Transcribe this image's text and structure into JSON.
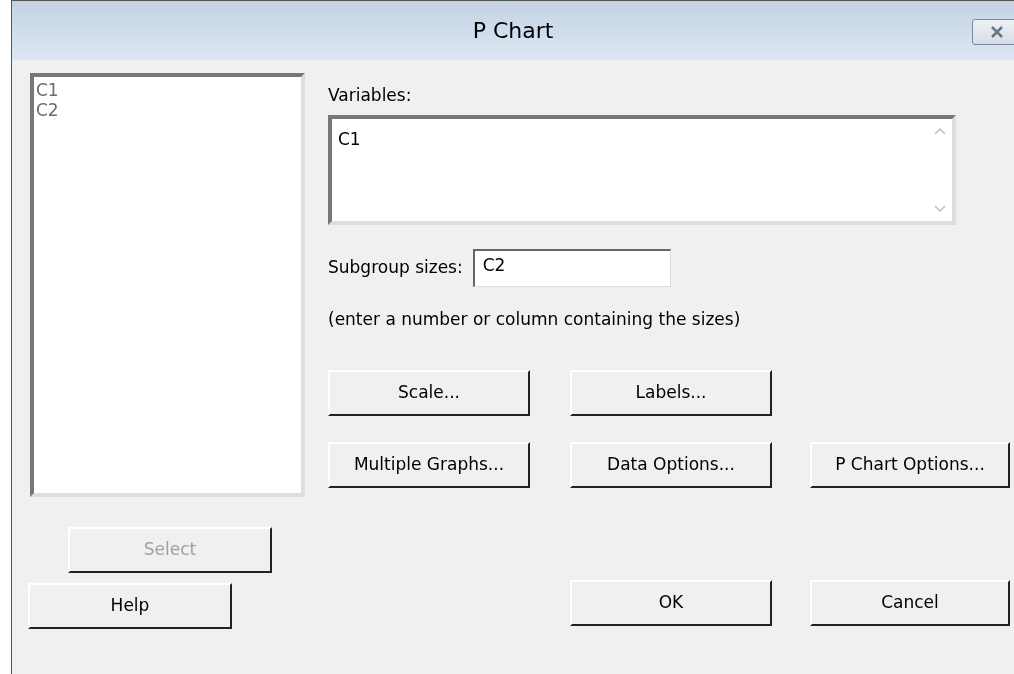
{
  "window": {
    "title": "P Chart"
  },
  "column_list": {
    "items": [
      "C1",
      "C2"
    ]
  },
  "select_button": {
    "label": "Select",
    "disabled": true
  },
  "variables": {
    "label": "Variables:",
    "value": "C1"
  },
  "subgroup_sizes": {
    "label": "Subgroup sizes:",
    "value": "C2"
  },
  "hint": "(enter a number or column containing the sizes)",
  "option_buttons": [
    {
      "label": "Scale..."
    },
    {
      "label": "Labels..."
    },
    {
      "label": "Multiple Graphs..."
    },
    {
      "label": "Data Options..."
    },
    {
      "label": "P Chart Options..."
    }
  ],
  "help_button": {
    "label": "Help"
  },
  "ok_button": {
    "label": "OK"
  },
  "cancel_button": {
    "label": "Cancel"
  }
}
